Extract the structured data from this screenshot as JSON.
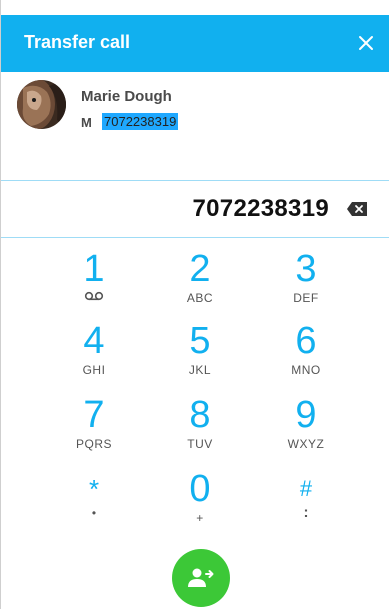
{
  "header": {
    "title": "Transfer call",
    "close_icon": "close-icon",
    "color": "#11b0ef"
  },
  "contact": {
    "name": "Marie Dough",
    "phone_type": "M",
    "number": "7072238319",
    "avatar_icon": "avatar-photo"
  },
  "dialer": {
    "display_number": "7072238319",
    "backspace_icon": "backspace-icon",
    "keys": [
      {
        "digit": "1",
        "letters": ""
      },
      {
        "digit": "2",
        "letters": "ABC"
      },
      {
        "digit": "3",
        "letters": "DEF"
      },
      {
        "digit": "4",
        "letters": "GHI"
      },
      {
        "digit": "5",
        "letters": "JKL"
      },
      {
        "digit": "6",
        "letters": "MNO"
      },
      {
        "digit": "7",
        "letters": "PQRS"
      },
      {
        "digit": "8",
        "letters": "TUV"
      },
      {
        "digit": "9",
        "letters": "WXYZ"
      },
      {
        "digit": "*",
        "letters": "•"
      },
      {
        "digit": "0",
        "letters": "+"
      },
      {
        "digit": "#",
        "letters": ":"
      }
    ],
    "transfer_button_icon": "transfer-person-icon",
    "transfer_button_color": "#3cc837"
  }
}
